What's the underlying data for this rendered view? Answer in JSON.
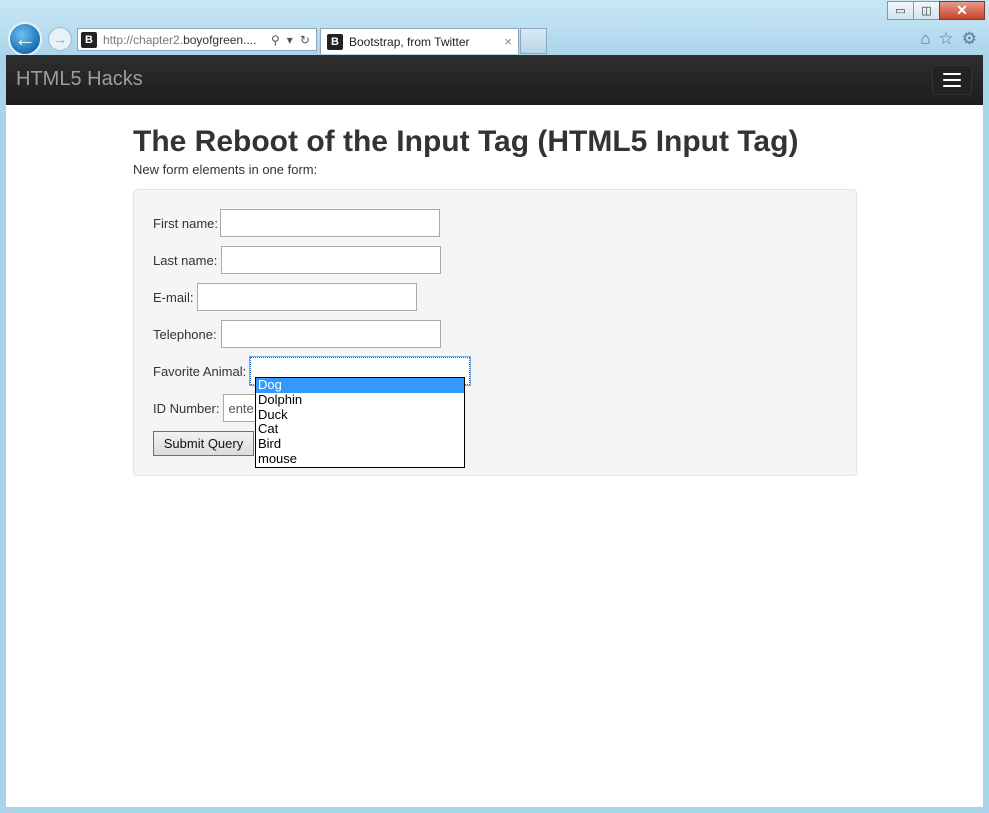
{
  "browser": {
    "address_prefix": "http://chapter2.",
    "address_domain": "boyofgreen....",
    "favicon_letter": "B",
    "tab_title": "Bootstrap, from Twitter",
    "tab_close": "×",
    "titlebar": {
      "minimize": "▭",
      "restore": "◫",
      "close": "✕"
    }
  },
  "navbar": {
    "brand": "HTML5 Hacks"
  },
  "page": {
    "heading": "The Reboot of the Input Tag (HTML5 Input Tag)",
    "subtitle": "New form elements in one form:"
  },
  "form": {
    "first_name_label": "First name:",
    "last_name_label": "Last name:",
    "email_label": "E-mail:",
    "telephone_label": "Telephone:",
    "animal_label": "Favorite Animal:",
    "id_label": "ID Number:",
    "id_placeholder": "ente",
    "submit_label": "Submit Query"
  },
  "animal_options": [
    "Dog",
    "Dolphin",
    "Duck",
    "Cat",
    "Bird",
    "mouse"
  ],
  "animal_selected": "Dog",
  "colors": {
    "navbar_bg": "#222222",
    "selection": "#3399ff"
  }
}
